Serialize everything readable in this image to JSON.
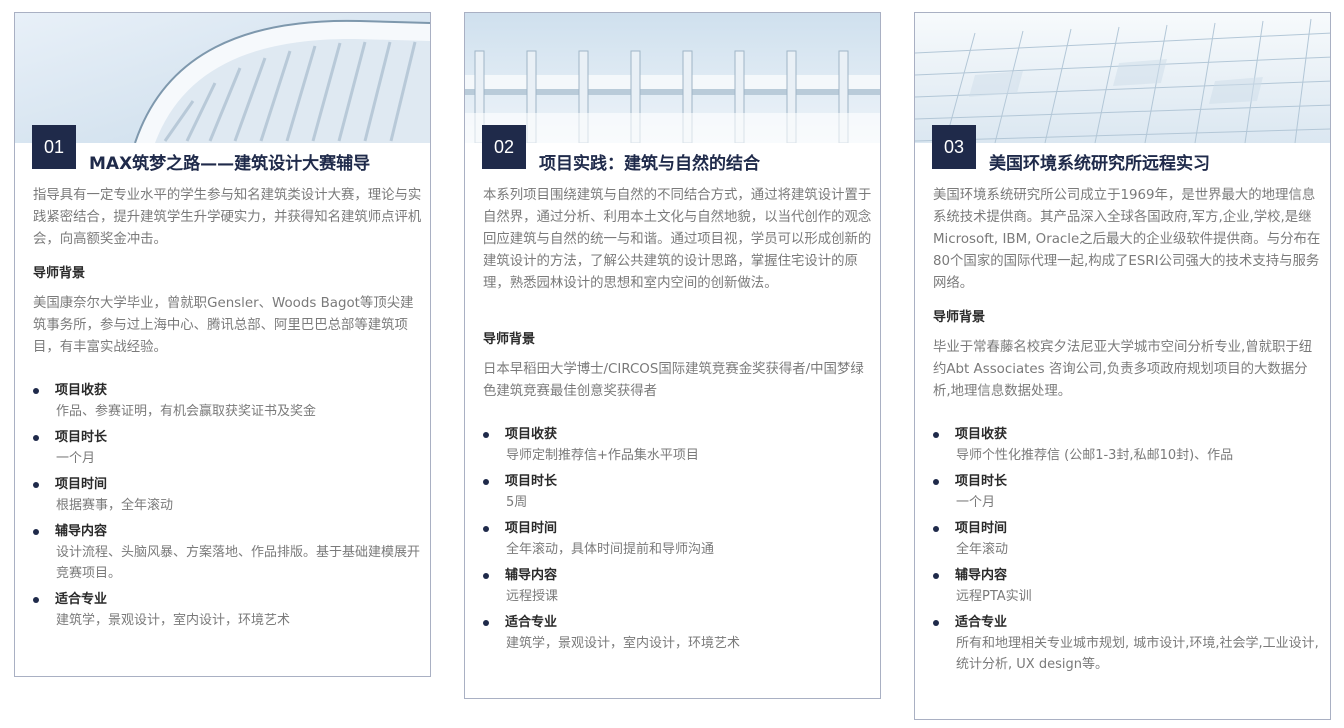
{
  "cards": [
    {
      "number": "01",
      "title": "MAX筑梦之路——建筑设计大赛辅导",
      "description": "指导具有一定专业水平的学生参与知名建筑类设计大赛，理论与实践紧密结合，提升建筑学生升学硬实力，并获得知名建筑师点评机会，向高额奖金冲击。",
      "mentor_heading": "导师背景",
      "mentor_text": "美国康奈尔大学毕业，曾就职Gensler、Woods Bagot等顶尖建筑事务所，参与过上海中心、腾讯总部、阿里巴巴总部等建筑项目，有丰富实战经验。",
      "features": [
        {
          "label": "项目收获",
          "value": "作品、参赛证明，有机会赢取获奖证书及奖金"
        },
        {
          "label": "项目时长",
          "value": "一个月"
        },
        {
          "label": "项目时间",
          "value": "根据赛事，全年滚动"
        },
        {
          "label": "辅导内容",
          "value": "设计流程、头脑风暴、方案落地、作品排版。基于基础建模展开竞赛项目。"
        },
        {
          "label": "适合专业",
          "value": "建筑学，景观设计，室内设计，环境艺术"
        }
      ]
    },
    {
      "number": "02",
      "title": "项目实践：建筑与自然的结合",
      "description": "本系列项目围绕建筑与自然的不同结合方式，通过将建筑设计置于自然界，通过分析、利用本土文化与自然地貌，以当代创作的观念回应建筑与自然的统一与和谐。通过项目视，学员可以形成创新的建筑设计的方法，了解公共建筑的设计思路，掌握住宅设计的原理，熟悉园林设计的思想和室内空间的创新做法。",
      "mentor_heading": "导师背景",
      "mentor_text": "日本早稻田大学博士/CIRCOS国际建筑竞赛金奖获得者/中国梦绿色建筑竞赛最佳创意奖获得者",
      "features": [
        {
          "label": "项目收获",
          "value": "导师定制推荐信+作品集水平项目"
        },
        {
          "label": "项目时长",
          "value": "5周"
        },
        {
          "label": "项目时间",
          "value": "全年滚动，具体时间提前和导师沟通"
        },
        {
          "label": "辅导内容",
          "value": "远程授课"
        },
        {
          "label": "适合专业",
          "value": "建筑学，景观设计，室内设计，环境艺术"
        }
      ]
    },
    {
      "number": "03",
      "title": "美国环境系统研究所远程实习",
      "description": "美国环境系统研究所公司成立于1969年，是世界最大的地理信息系统技术提供商。其产品深入全球各国政府,军方,企业,学校,是继Microsoft, IBM, Oracle之后最大的企业级软件提供商。与分布在80个国家的国际代理一起,构成了ESRI公司强大的技术支持与服务网络。",
      "mentor_heading": "导师背景",
      "mentor_text": "毕业于常春藤名校宾夕法尼亚大学城市空间分析专业,曾就职于纽约Abt Associates 咨询公司,负责多项政府规划项目的大数据分析,地理信息数据处理。",
      "features": [
        {
          "label": "项目收获",
          "value": "导师个性化推荐信 (公邮1-3封,私邮10封)、作品"
        },
        {
          "label": "项目时长",
          "value": "一个月"
        },
        {
          "label": "项目时间",
          "value": "全年滚动"
        },
        {
          "label": "辅导内容",
          "value": "远程PTA实训"
        },
        {
          "label": "适合专业",
          "value": "所有和地理相关专业城市规划, 城市设计,环境,社会学,工业设计,统计分析, UX design等。"
        }
      ]
    }
  ]
}
